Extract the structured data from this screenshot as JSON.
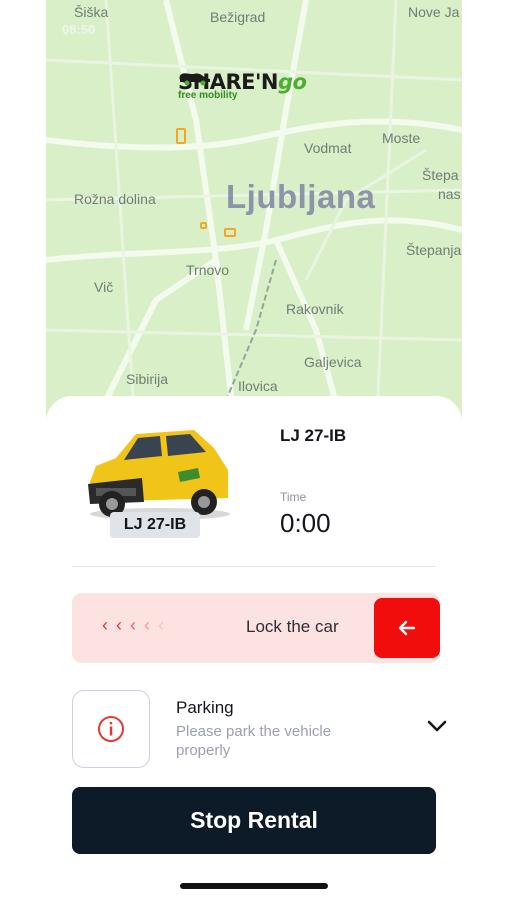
{
  "status_bar": {
    "time": "08:50"
  },
  "brand": {
    "name_part1": "SHARE'N",
    "name_part2": "go",
    "tagline": "free mobility"
  },
  "map": {
    "city": "Ljubljana",
    "places": [
      "Šiška",
      "Bežigrad",
      "Nove Ja",
      "Moste",
      "Vodmat",
      "Štepa",
      "nas",
      "Rožna dolina",
      "Štepanja",
      "Trnovo",
      "Vič",
      "Rakovnik",
      "Galjevica",
      "Sibirija",
      "Ilovica"
    ]
  },
  "rental": {
    "plate": "LJ 27-IB",
    "plate_badge": "LJ 27-IB",
    "time_label": "Time",
    "time_value": "0:00"
  },
  "lock": {
    "label": "Lock the car",
    "chevrons": [
      "‹",
      "‹",
      "‹",
      "‹",
      "‹"
    ],
    "chevron_colors": [
      "#e53935",
      "#e53935",
      "#ee6464",
      "#f39a9a",
      "#f8c3c3"
    ],
    "button_icon": "arrow-left-icon"
  },
  "parking": {
    "title": "Parking",
    "subtitle": "Please park the vehicle properly",
    "icon": "info-icon"
  },
  "actions": {
    "stop_label": "Stop Rental"
  },
  "colors": {
    "accent_red": "#f20d0d",
    "dark": "#0d1b29",
    "map_green": "#d9efc8"
  }
}
